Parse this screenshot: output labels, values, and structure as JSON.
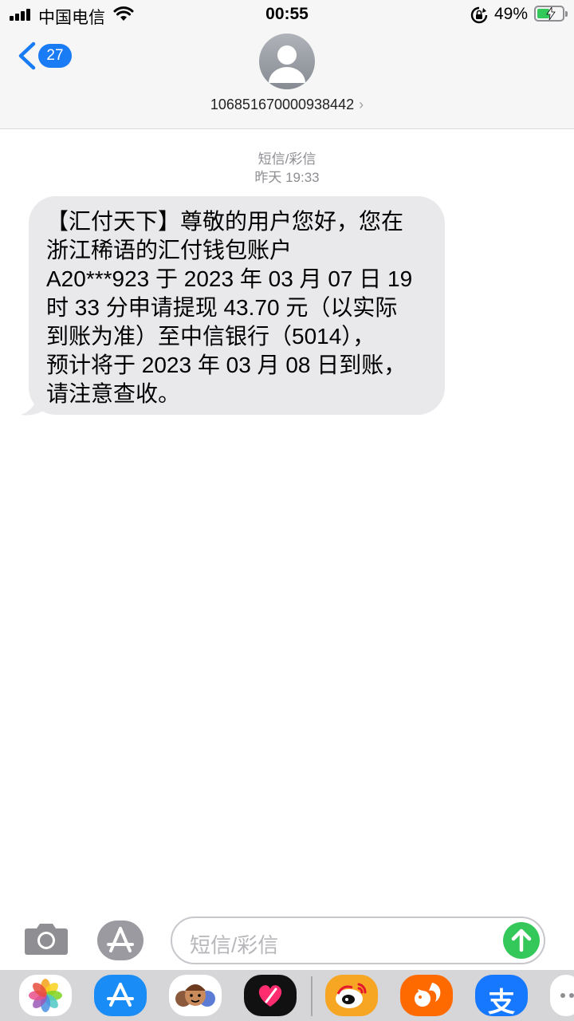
{
  "status_bar": {
    "carrier": "中国电信",
    "time": "00:55",
    "battery_percent": "49%",
    "battery_level": 0.49,
    "icons": [
      "signal-icon",
      "wifi-icon",
      "orientation-lock-icon",
      "battery-charging-icon"
    ]
  },
  "header": {
    "back_count": "27",
    "contact": "106851670000938442",
    "contact_chevron": "›"
  },
  "conversation": {
    "message_type": "短信/彩信",
    "timestamp": "昨天 19:33",
    "messages": [
      {
        "direction": "incoming",
        "lines": [
          "【汇付天下】尊敬的用户您好，您在",
          "浙江稀语的汇付钱包账户",
          "A20***923 于 2023 年 03 月 07 日 19",
          "时 33 分申请提现 43.70 元（以实际",
          "到账为准）至中信银行（5014），",
          "预计将于 2023 年 03 月 08 日到账，",
          "请注意查收。"
        ]
      }
    ]
  },
  "composer": {
    "placeholder": "短信/彩信",
    "icons": [
      "camera-icon",
      "app-store-icon",
      "send-arrow-icon"
    ]
  },
  "app_drawer": {
    "apps": [
      "photos-icon",
      "app-store-icon",
      "memoji-icon",
      "digital-touch-icon",
      "weibo-icon",
      "squirrel-app-icon",
      "alipay-icon",
      "more-icon"
    ],
    "alipay_glyph": "支"
  },
  "colors": {
    "accent_blue": "#1a7cf5",
    "bubble_gray": "#e9e9eb",
    "send_green": "#34c759",
    "weibo_orange": "#f7a623",
    "alipay_blue": "#1677ff"
  }
}
